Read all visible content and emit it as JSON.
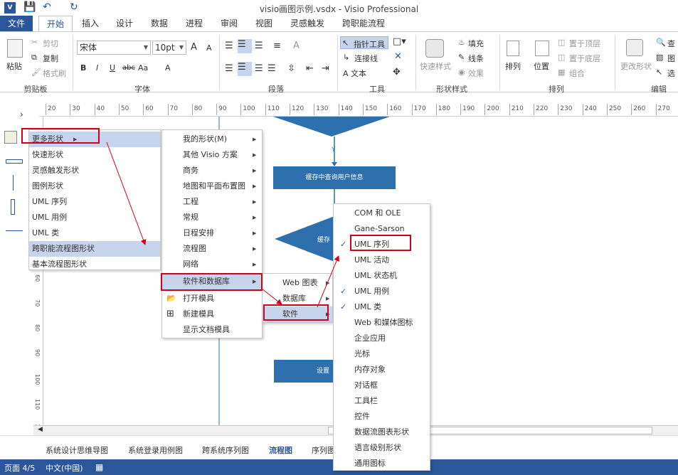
{
  "window": {
    "title": "visio画图示例.vsdx - Visio Professional",
    "app_badge": "V"
  },
  "tabs": [
    "文件",
    "开始",
    "插入",
    "设计",
    "数据",
    "进程",
    "审阅",
    "视图",
    "灵感触发",
    "跨职能流程图"
  ],
  "ribbon": {
    "clipboard": {
      "label": "剪贴板",
      "paste": "粘贴",
      "cut": "剪切",
      "copy": "复制",
      "format_painter": "格式刷"
    },
    "font": {
      "label": "字体",
      "font_name": "宋体",
      "font_size": "10pt",
      "bold": "B",
      "italic": "I",
      "underline": "U",
      "strike": "abc",
      "case": "Aa",
      "grow": "A",
      "shrink": "A",
      "color": "A"
    },
    "paragraph": {
      "label": "段落"
    },
    "tools": {
      "label": "工具",
      "pointer": "指针工具",
      "connector": "连接线",
      "text": "A 文本"
    },
    "shape_styles": {
      "label": "形状样式",
      "quick_styles": "快速样式",
      "fill": "填充",
      "line": "线条",
      "effects": "效果"
    },
    "arrange": {
      "label": "排列",
      "arrange": "排列",
      "position": "位置",
      "bring_front": "置于顶层",
      "send_back": "置于底层",
      "group": "组合"
    },
    "edit": {
      "label": "编辑",
      "change_shape": "更改形状",
      "find": "查",
      "layers": "图",
      "select": "选"
    }
  },
  "ruler": {
    "ticks": [
      "20",
      "30",
      "40",
      "50",
      "60",
      "70",
      "80",
      "90",
      "100",
      "110",
      "120",
      "130",
      "140",
      "150",
      "160",
      "170",
      "180",
      "190",
      "200",
      "210",
      "220",
      "230",
      "240",
      "250",
      "260",
      "270"
    ]
  },
  "vruler": {
    "ticks": [
      "60",
      "70",
      "80",
      "90",
      "100",
      "110",
      "120"
    ]
  },
  "flow": {
    "box1": "缓存中查询用户信息",
    "diamond_text": "缓存",
    "y_label": "Y",
    "box3": "设置"
  },
  "menu1": {
    "items": [
      "更多形状",
      "快速形状",
      "灵感触发形状",
      "图例形状",
      "UML 序列",
      "UML 用例",
      "UML 类",
      "跨职能流程图形状",
      "基本流程图形状"
    ]
  },
  "menu2": {
    "items": [
      "我的形状(M)",
      "其他 Visio 方案",
      "商务",
      "地图和平面布置图",
      "工程",
      "常规",
      "日程安排",
      "流程图",
      "网络",
      "软件和数据库",
      "打开模具",
      "新建模具",
      "显示文档模具"
    ]
  },
  "menu3": {
    "items": [
      "Web 图表",
      "数据库",
      "软件"
    ]
  },
  "menu4": {
    "items": [
      "COM 和 OLE",
      "Gane-Sarson",
      "UML 序列",
      "UML 活动",
      "UML 状态机",
      "UML 用例",
      "UML 类",
      "Web 和媒体图标",
      "企业应用",
      "光标",
      "内存对象",
      "对话框",
      "工具栏",
      "控件",
      "数据流图表形状",
      "语言级别形状",
      "通用图标"
    ],
    "checked": [
      "UML 序列",
      "UML 用例",
      "UML 类"
    ]
  },
  "page_tabs": [
    "系统设计思维导图",
    "系统登录用例图",
    "跨系统序列图",
    "流程图",
    "序列图"
  ],
  "status": {
    "page": "页面 4/5",
    "language": "中文(中国)"
  },
  "colors": {
    "accent": "#2b579a",
    "highlight": "#c7d4ee",
    "red": "#d0021b",
    "flow": "#2e6fae"
  }
}
